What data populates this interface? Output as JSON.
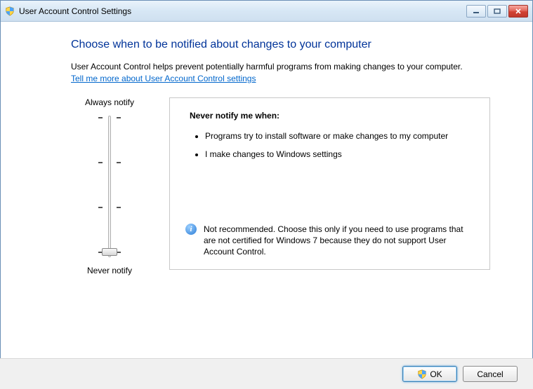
{
  "window": {
    "title": "User Account Control Settings"
  },
  "heading": "Choose when to be notified about changes to your computer",
  "description": "User Account Control helps prevent potentially harmful programs from making changes to your computer.",
  "link_text": "Tell me more about User Account Control settings",
  "slider": {
    "top_label": "Always notify",
    "bottom_label": "Never notify"
  },
  "panel": {
    "title": "Never notify me when:",
    "bullets": [
      "Programs try to install software or make changes to my computer",
      "I make changes to Windows settings"
    ],
    "recommendation": "Not recommended. Choose this only if you need to use programs that are not certified for Windows 7 because they do not support User Account Control."
  },
  "buttons": {
    "ok": "OK",
    "cancel": "Cancel"
  }
}
